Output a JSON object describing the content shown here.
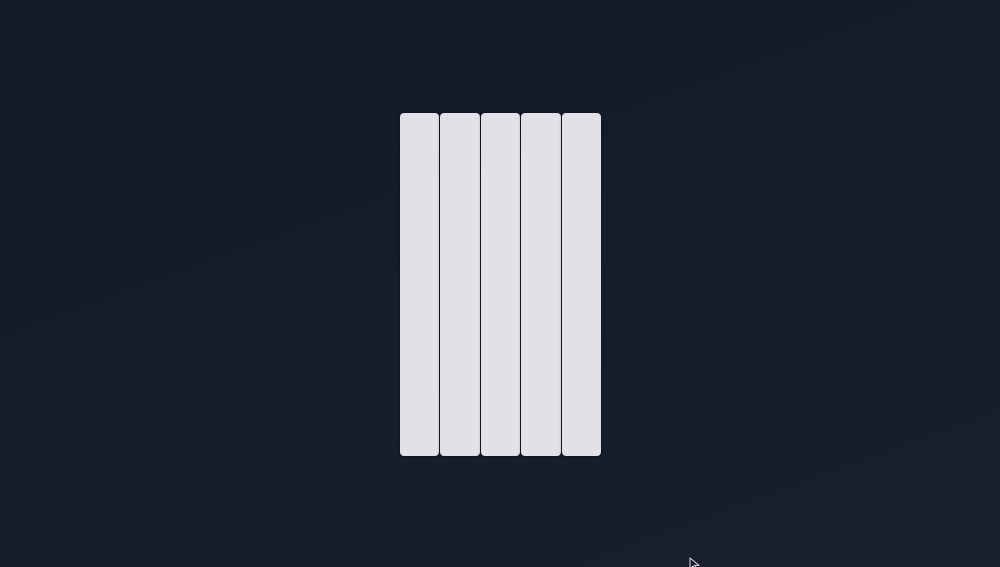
{
  "colors": {
    "panel": "#e1e2e6",
    "cursor_fill": "#1a1f2c",
    "cursor_stroke": "#d8dae0"
  },
  "panels": [
    {
      "id": "panel-1"
    },
    {
      "id": "panel-2"
    },
    {
      "id": "panel-3"
    },
    {
      "id": "panel-4"
    },
    {
      "id": "panel-5"
    }
  ],
  "cursor": {
    "icon": "arrow-cursor-icon"
  }
}
